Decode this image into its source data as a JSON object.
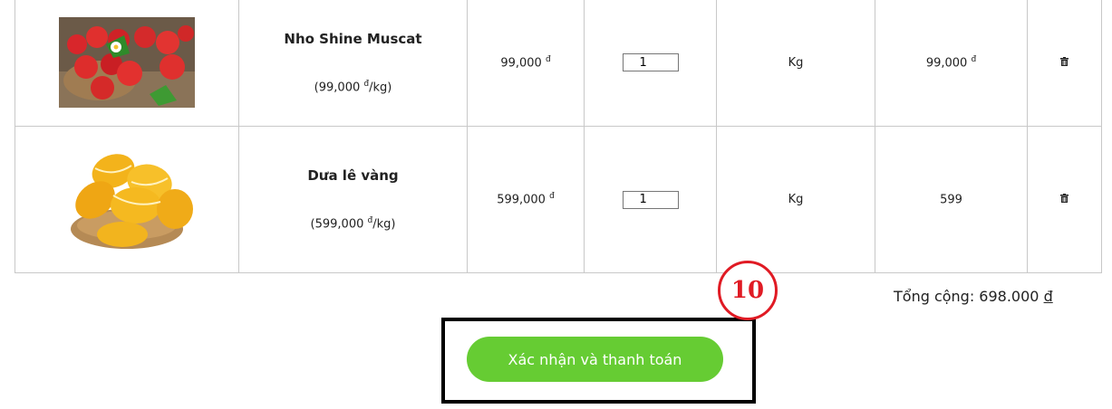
{
  "cart": {
    "rows": [
      {
        "name": "Nho Shine Muscat",
        "unit_price_prefix": "(99,000 ",
        "unit_price_currency": "đ",
        "unit_price_suffix": "/kg)",
        "price": "99,000",
        "currency": "đ",
        "quantity": "1",
        "unit": "Kg",
        "subtotal": "99,000",
        "subtotal_currency": "đ",
        "image": "strawberries"
      },
      {
        "name": "Dưa lê vàng",
        "unit_price_prefix": "(599,000 ",
        "unit_price_currency": "đ",
        "unit_price_suffix": "/kg)",
        "price": "599,000",
        "currency": "đ",
        "quantity": "1",
        "unit": "Kg",
        "subtotal": "599",
        "subtotal_currency": "",
        "image": "yellow-melons"
      }
    ]
  },
  "total": {
    "label": "Tổng cộng: 698.000 ",
    "currency": "đ"
  },
  "confirm_button": {
    "label": "Xác nhận và thanh toán"
  },
  "annotation": {
    "number": "10",
    "color": "#e01b24"
  },
  "colors": {
    "button": "#66cc33",
    "border": "#c8c8c8"
  },
  "icons": {
    "delete": "trash-icon"
  }
}
